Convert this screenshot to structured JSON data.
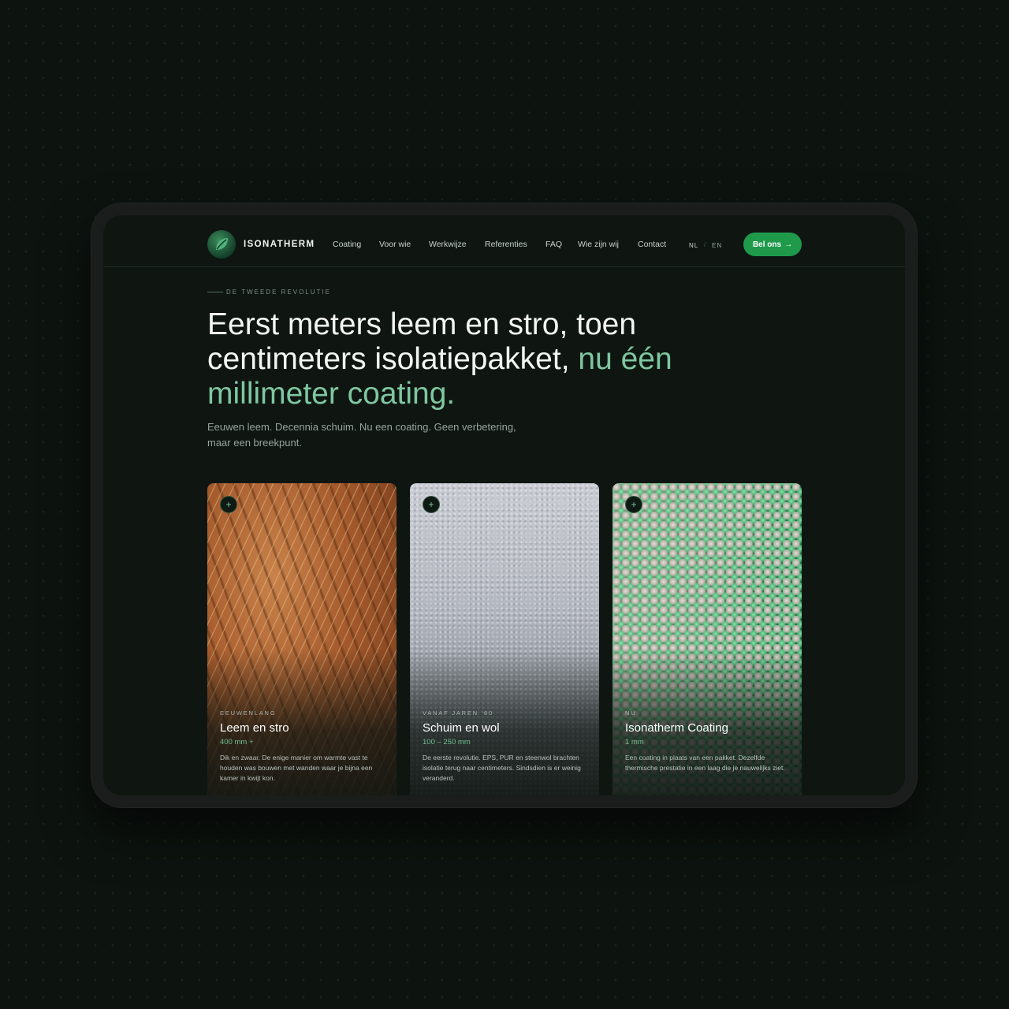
{
  "header": {
    "brand": "ISONATHERM",
    "nav": [
      "Coating",
      "Voor wie",
      "Werkwijze",
      "Referenties",
      "FAQ",
      "Wie zijn wij",
      "Contact"
    ],
    "lang": [
      "NL",
      "EN"
    ],
    "lang_separator": "/",
    "cta_label": "Bel ons",
    "cta_icon": "→"
  },
  "hero": {
    "eyebrow": "DE TWEEDE REVOLUTIE",
    "headline_main": "Eerst meters leem en stro, toen centimeters isolatiepakket,",
    "headline_accent": "nu één millimeter coating.",
    "subline": "Eeuwen leem. Decennia schuim. Nu een coating. Geen verbetering, maar een breekpunt."
  },
  "cards": [
    {
      "eyebrow": "EEUWENLANG",
      "title": "Leem en stro",
      "size": "400 mm +",
      "description": "Dik en zwaar. De enige manier om warmte vast te houden was bouwen met wanden waar je bijna een kamer in kwijt kon.",
      "icon": "plus-icon"
    },
    {
      "eyebrow": "VANAF JAREN '60",
      "title": "Schuim en wol",
      "size": "100 – 250 mm",
      "description": "De eerste revolutie. EPS, PUR en steenwol brachten isolatie terug naar centimeters. Sindsdien is er weinig veranderd.",
      "icon": "plus-icon"
    },
    {
      "eyebrow": "NU",
      "title": "Isonatherm Coating",
      "size": "1 mm",
      "description": "Een coating in plaats van een pakket. Dezelfde thermische prestatie in een laag die je nauwelijks ziet.",
      "icon": "plus-icon"
    }
  ],
  "colors": {
    "background": "#0d1410",
    "accent": "#7fc7a0",
    "cta": "#1f9a4b"
  }
}
